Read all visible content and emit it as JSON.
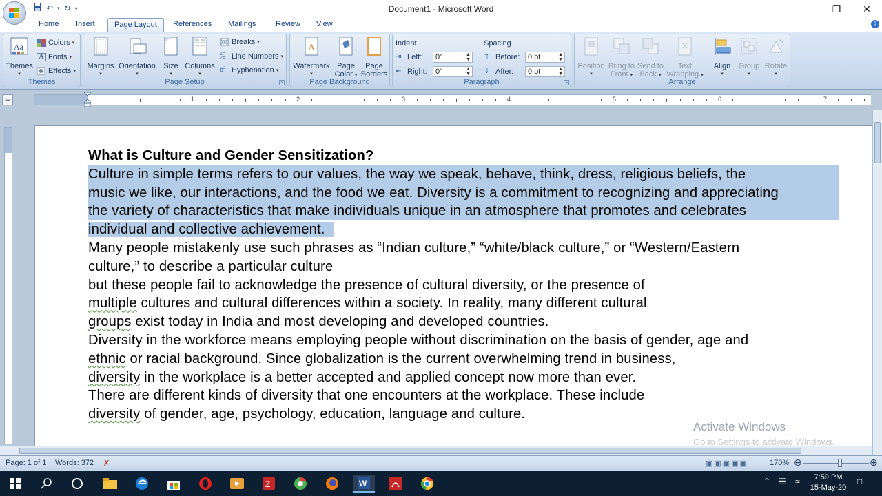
{
  "window": {
    "title": "Document1 - Microsoft Word",
    "minimize": "–",
    "restore": "❐",
    "close": "✕"
  },
  "tabs": [
    "Home",
    "Insert",
    "Page Layout",
    "References",
    "Mailings",
    "Review",
    "View"
  ],
  "active_tab": "Page Layout",
  "ribbon": {
    "themes": {
      "themes_btn": "Themes",
      "colors": "Colors",
      "fonts": "Fonts",
      "effects": "Effects",
      "label": "Themes"
    },
    "page_setup": {
      "margins": "Margins",
      "orientation": "Orientation",
      "size": "Size",
      "columns": "Columns",
      "breaks": "Breaks",
      "line_numbers": "Line Numbers",
      "hyphenation": "Hyphenation",
      "label": "Page Setup"
    },
    "page_background": {
      "watermark": "Watermark",
      "page_color_1": "Page",
      "page_color_2": "Color",
      "page_borders_1": "Page",
      "page_borders_2": "Borders",
      "label": "Page Background"
    },
    "paragraph": {
      "indent": "Indent",
      "left_label": "Left:",
      "left_value": "0\"",
      "right_label": "Right:",
      "right_value": "0\"",
      "spacing": "Spacing",
      "before_label": "Before:",
      "before_value": "0 pt",
      "after_label": "After:",
      "after_value": "0 pt",
      "label": "Paragraph"
    },
    "arrange": {
      "position": "Position",
      "bring_front_1": "Bring to",
      "bring_front_2": "Front",
      "send_back_1": "Send to",
      "send_back_2": "Back",
      "text_wrap_1": "Text",
      "text_wrap_2": "Wrapping",
      "align": "Align",
      "group": "Group",
      "rotate": "Rotate",
      "label": "Arrange"
    }
  },
  "ruler_numbers": [
    "1",
    "2",
    "3",
    "4",
    "5",
    "6",
    "7"
  ],
  "document": {
    "heading": "What is Culture and Gender Sensitization?",
    "sel_lines": [
      "Culture in simple terms refers to our values, the way we speak, behave, think, dress, religious beliefs, the",
      "music we like, our interactions, and the food we eat. Diversity is a commitment to recognizing and appreciating",
      "the variety of characteristics that make individuals unique in an atmosphere that promotes and celebrates",
      "individual and collective achievement."
    ],
    "line5": "Many people mistakenly use such phrases as “Indian culture,” “white/black culture,” or “Western/Eastern",
    "line6": "culture,” to describe a particular culture",
    "line7": "but these people fail to acknowledge the presence of cultural diversity, or the presence of",
    "line8a": "multiple",
    "line8b": " cultures and cultural differences within a society. In reality, many different cultural",
    "line9a": "groups",
    "line9b": " exist today in India and most developing and developed countries.",
    "line10": "Diversity in the workforce means employing people without discrimination on the basis of gender, age and",
    "line11a": "ethnic",
    "line11b": " or racial background. Since globalization is the current overwhelming trend in business,",
    "line12a": "diversity",
    "line12b": " in the workplace is a better accepted and applied concept now more than ever.",
    "line13": "There are different kinds of diversity that one encounters at the workplace. These include",
    "line14a": "diversity",
    "line14b": " of gender, age, psychology, education, language and culture."
  },
  "watermark": {
    "line1": "Activate Windows",
    "line2": "Go to Settings to activate Windows."
  },
  "status": {
    "page": "Page: 1 of 1",
    "words": "Words: 372",
    "zoom": "170%"
  },
  "taskbar": {
    "time": "7:59 PM",
    "date": "15-May-20"
  },
  "colors": {
    "selection": "#b3cce8",
    "ribbon": "#dce7f5",
    "taskbar": "#0c1f33"
  }
}
